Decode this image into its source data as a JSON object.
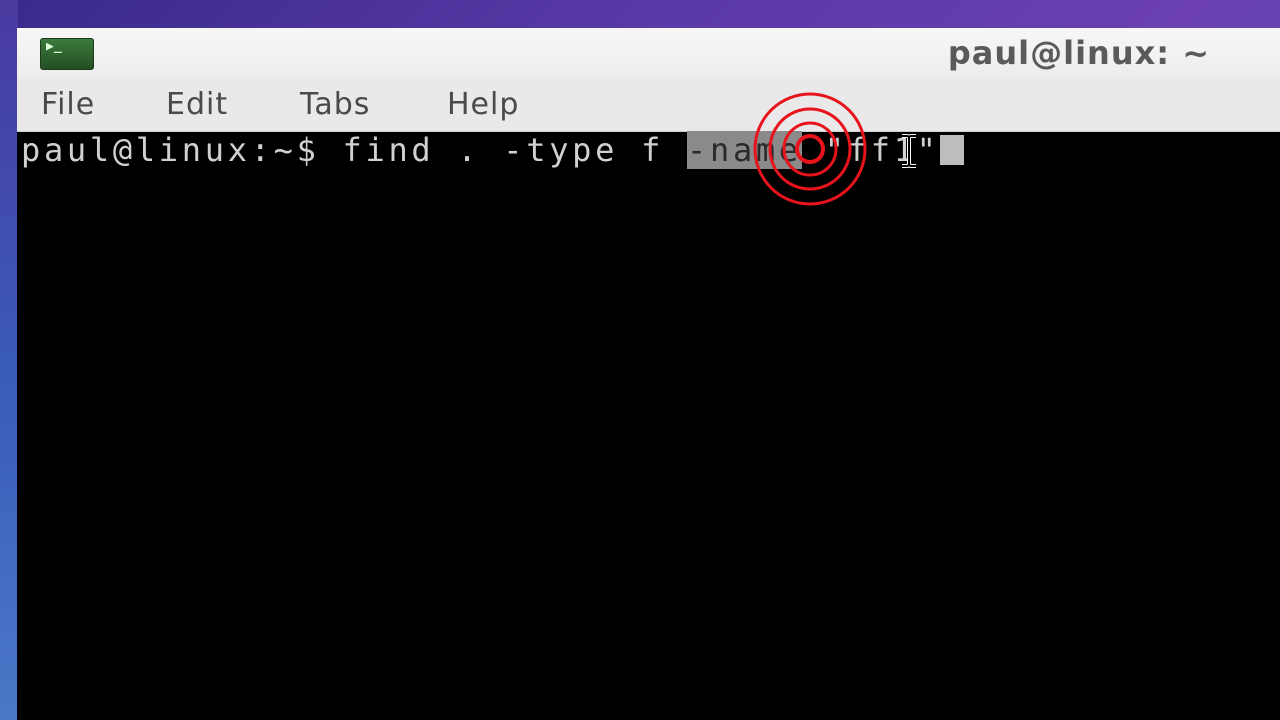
{
  "window": {
    "title": "paul@linux: ~",
    "icon": "terminal-icon",
    "icon_glyph": "▶_"
  },
  "menubar": {
    "items": [
      {
        "label": "File"
      },
      {
        "label": "Edit"
      },
      {
        "label": "Tabs"
      },
      {
        "label": "Help"
      }
    ]
  },
  "terminal": {
    "prompt": "paul@linux:~$ ",
    "command_before": "find . -type f ",
    "command_selected": "-name",
    "command_after": " \"ff1\"",
    "background": "#000000",
    "foreground": "#d0d0d0"
  },
  "overlay": {
    "click_indicator_color": "#e8141c",
    "pointer": "ibeam-cursor-icon"
  },
  "colors": {
    "titlebar": "#f2f2f2",
    "menubar": "#e9e9e9",
    "desktop": "#5a3aa8"
  }
}
